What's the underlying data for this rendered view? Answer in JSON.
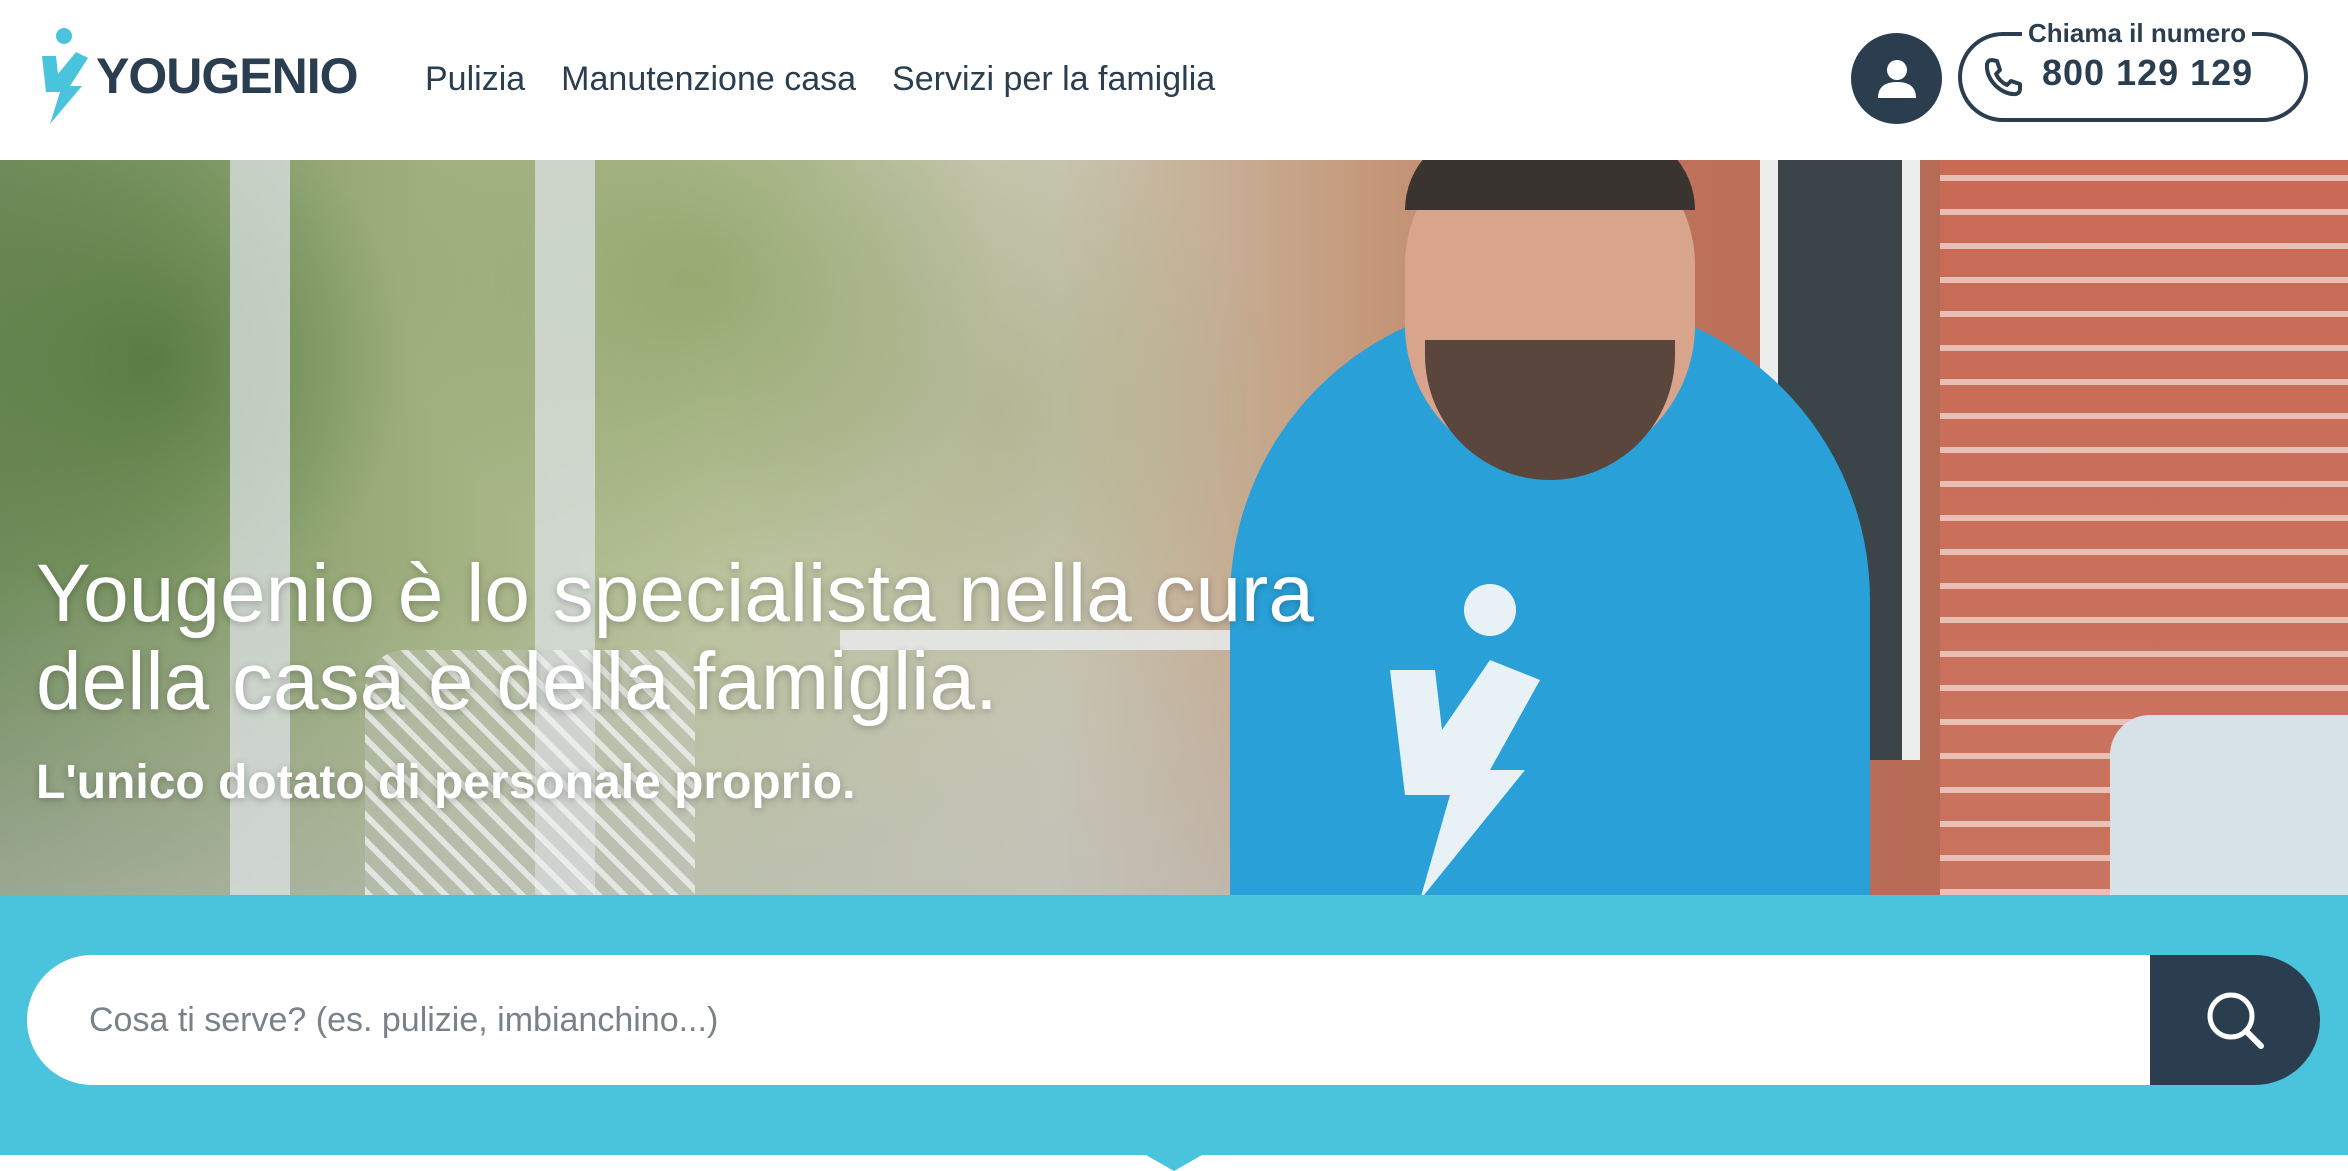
{
  "brand": {
    "name": "YOUGENIO",
    "accent_color": "#4ac3dd",
    "dark_color": "#2b3e50"
  },
  "nav": {
    "items": [
      {
        "label": "Pulizia"
      },
      {
        "label": "Manutenzione casa"
      },
      {
        "label": "Servizi per la famiglia"
      }
    ]
  },
  "header": {
    "user_icon": "user-icon",
    "phone": {
      "caption": "Chiama il numero",
      "number": "800 129 129",
      "icon": "phone-icon"
    }
  },
  "hero": {
    "title": "Yougenio è lo specialista nella cura della casa e della famiglia.",
    "subtitle": "L'unico dotato di personale proprio."
  },
  "search": {
    "placeholder": "Cosa ti serve? (es. pulizie, imbianchino...)",
    "value": "",
    "icon": "search-icon"
  }
}
